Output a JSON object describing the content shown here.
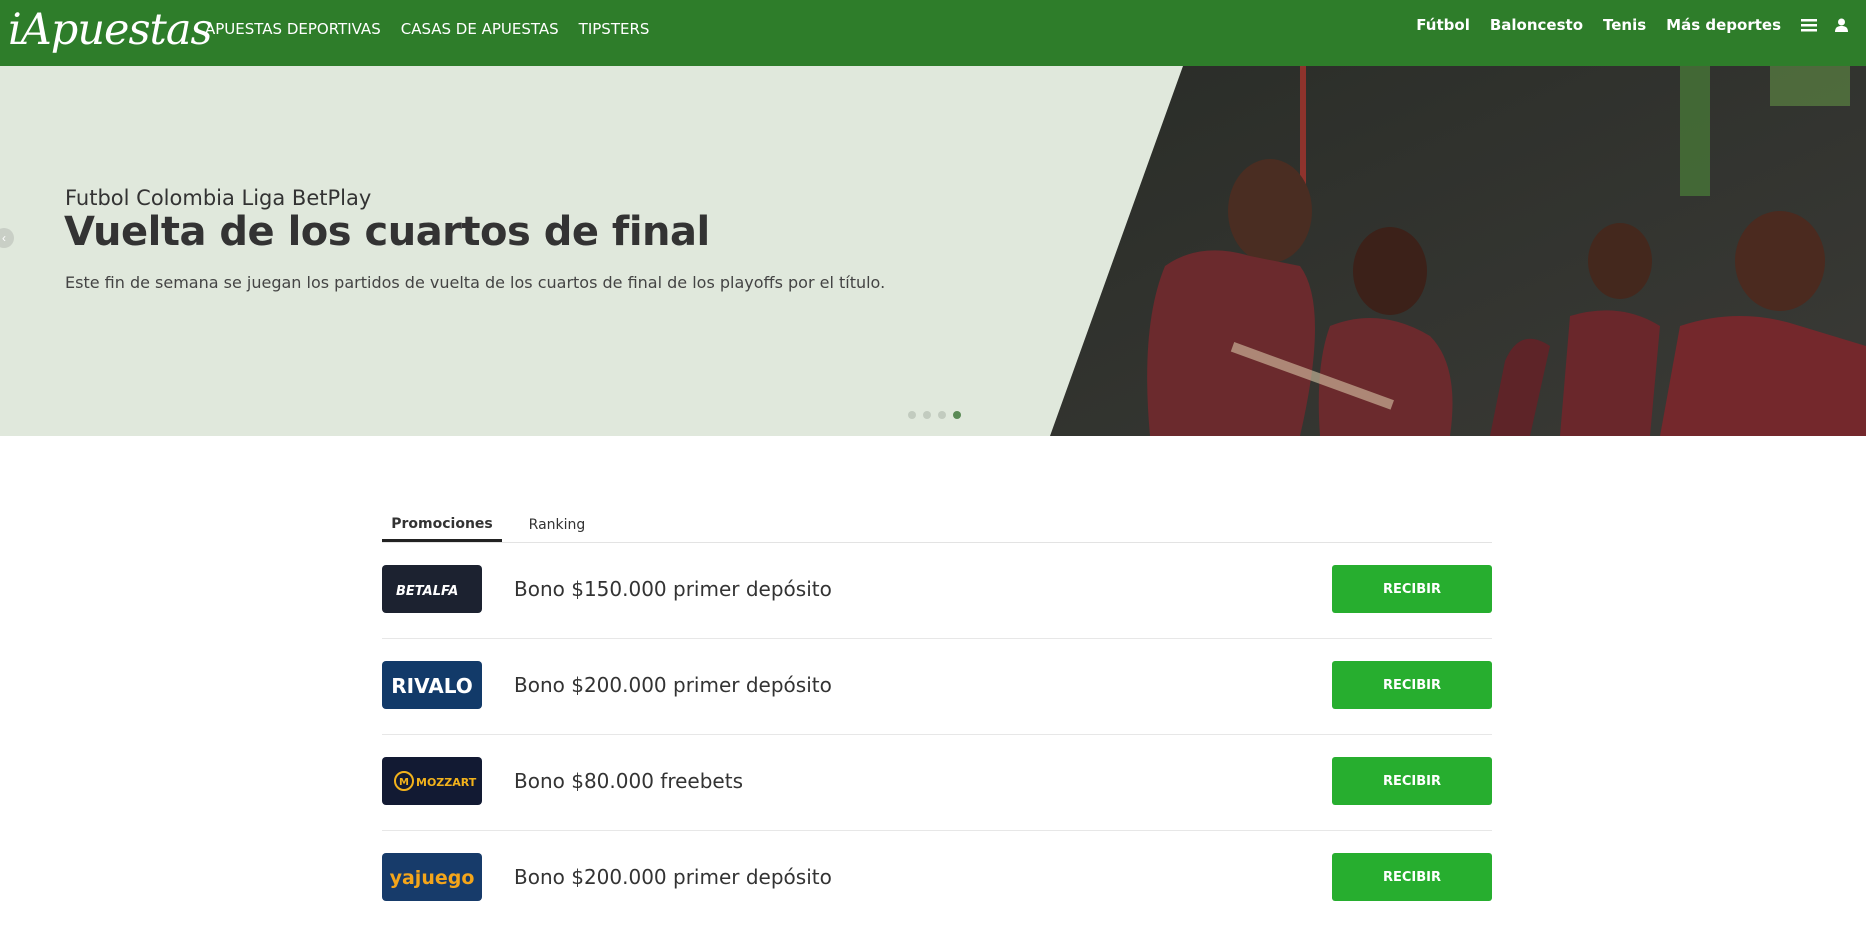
{
  "header": {
    "logo": "iApuestas",
    "main_nav": [
      "APUESTAS DEPORTIVAS",
      "CASAS DE APUESTAS",
      "TIPSTERS"
    ],
    "sports_nav": [
      "Fútbol",
      "Baloncesto",
      "Tenis",
      "Más deportes"
    ]
  },
  "hero": {
    "subtitle": "Futbol Colombia Liga BetPlay",
    "title": "Vuelta de los cuartos de final",
    "description": "Este fin de semana se juegan los partidos de vuelta de los cuartos de final de los playoffs por el título.",
    "slide_count": 4,
    "active_slide": 4
  },
  "tabs": [
    "Promociones",
    "Ranking"
  ],
  "promotions": [
    {
      "brand": "BETALFA",
      "text": "Bono $150.000 primer depósito",
      "cta": "RECIBIR"
    },
    {
      "brand": "RIVALO",
      "text": "Bono $200.000 primer depósito",
      "cta": "RECIBIR"
    },
    {
      "brand": "MOZZART",
      "text": "Bono $80.000 freebets",
      "cta": "RECIBIR"
    },
    {
      "brand": "yajuego",
      "text": "Bono $200.000 primer depósito",
      "cta": "RECIBIR"
    }
  ],
  "colors": {
    "header_green": "#2e7d2a",
    "cta_green": "#27ae2f",
    "hero_bg": "#e0e8dc"
  },
  "icons": [
    "menu-icon",
    "user-icon",
    "chevron-left-icon"
  ]
}
